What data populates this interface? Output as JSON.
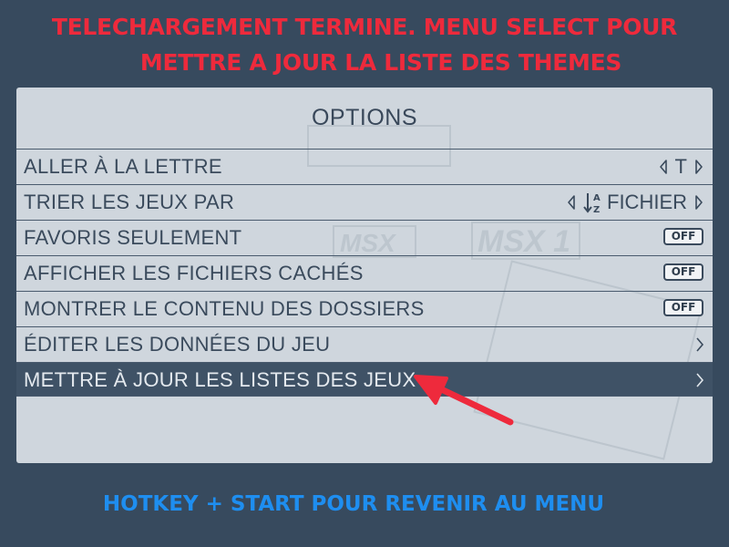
{
  "banner": {
    "line1": "TELECHARGEMENT TERMINE. MENU SELECT POUR",
    "line2": "METTRE A JOUR LA LISTE DES THEMES",
    "color": "#ee2a3c"
  },
  "menu": {
    "title": "OPTIONS",
    "items": [
      {
        "label": "ALLER À LA LETTRE",
        "type": "selector",
        "value": "T"
      },
      {
        "label": "TRIER LES JEUX PAR",
        "type": "selector",
        "value": "FICHIER",
        "icon": "sort-az-icon"
      },
      {
        "label": "FAVORIS SEULEMENT",
        "type": "switch",
        "value": "OFF"
      },
      {
        "label": "AFFICHER LES FICHIERS CACHÉS",
        "type": "switch",
        "value": "OFF"
      },
      {
        "label": "MONTRER LE CONTENU DES DOSSIERS",
        "type": "switch",
        "value": "OFF"
      },
      {
        "label": "ÉDITER LES DONNÉES DU JEU",
        "type": "submenu"
      },
      {
        "label": "METTRE À JOUR LES LISTES DES JEUX",
        "type": "submenu",
        "selected": true
      }
    ]
  },
  "background_art": {
    "logo_text": "MSX 1",
    "small_logo_text": "MSX"
  },
  "hint": {
    "text": "HOTKEY + START POUR REVENIR AU MENU",
    "color": "#1e8ef0"
  },
  "annotation": {
    "icon": "red-pointer-arrow-icon",
    "color": "#ee2a3c"
  }
}
